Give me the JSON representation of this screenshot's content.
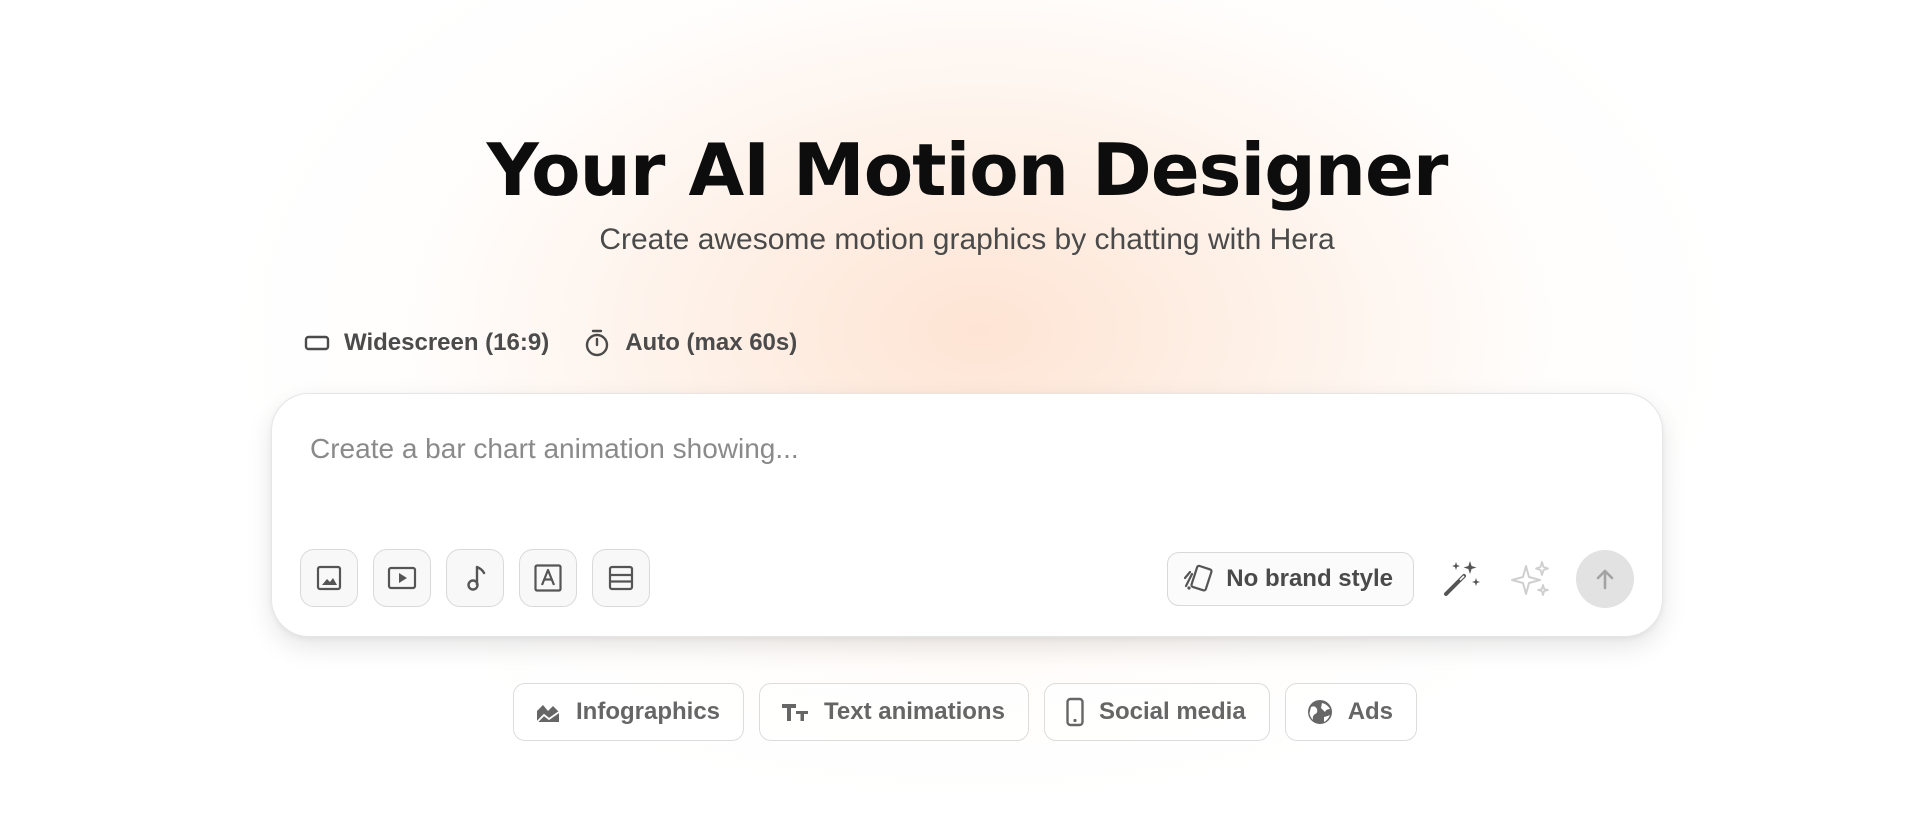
{
  "hero": {
    "title": "Your AI Motion Designer",
    "subtitle": "Create awesome motion graphics by chatting with Hera"
  },
  "options": {
    "aspect_ratio": {
      "label": "Widescreen (16:9)",
      "icon": "widescreen-icon"
    },
    "duration": {
      "label": "Auto (max 60s)",
      "icon": "stopwatch-icon"
    }
  },
  "composer": {
    "placeholder": "Create a bar chart animation showing...",
    "value": "",
    "tools": [
      {
        "icon": "image-icon"
      },
      {
        "icon": "video-icon"
      },
      {
        "icon": "music-note-icon"
      },
      {
        "icon": "text-font-icon"
      },
      {
        "icon": "layout-icon"
      }
    ],
    "brand_style_label": "No brand style",
    "brand_style_icon": "brand-cards-icon",
    "magic_icon": "magic-wand-icon",
    "sparkle_icon": "sparkles-icon",
    "send_icon": "arrow-up-icon"
  },
  "suggestions": [
    {
      "label": "Infographics",
      "icon": "chart-image-icon"
    },
    {
      "label": "Text animations",
      "icon": "text-size-icon"
    },
    {
      "label": "Social media",
      "icon": "smartphone-icon"
    },
    {
      "label": "Ads",
      "icon": "globe-icon"
    }
  ],
  "colors": {
    "glow": "#fdd3b8",
    "title": "#0d0d0d",
    "send_button_disabled": "#e2e2e2"
  }
}
